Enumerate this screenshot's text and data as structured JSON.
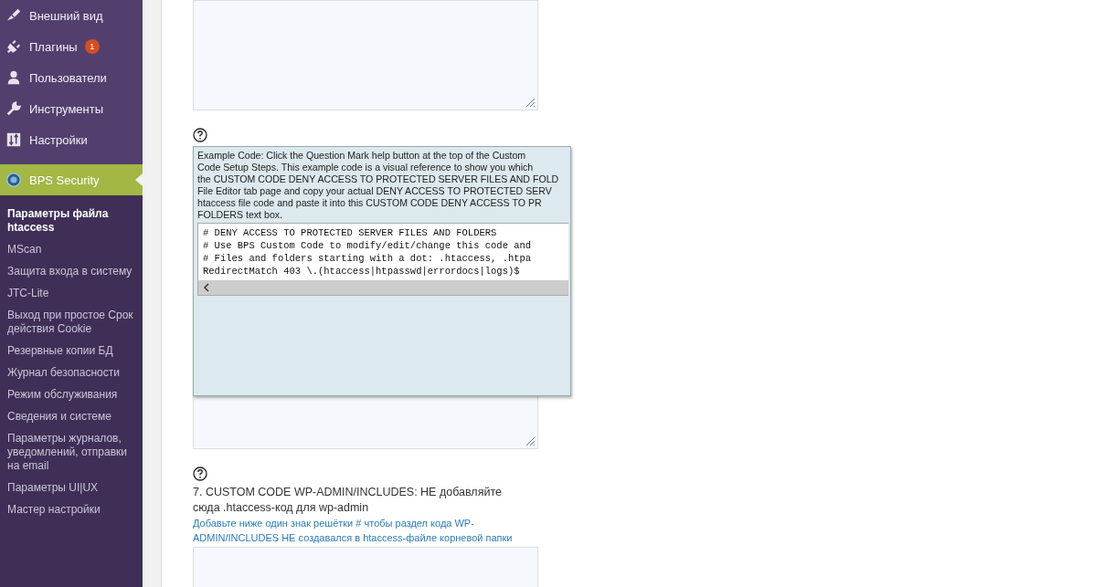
{
  "sidebar": {
    "menu": [
      {
        "label": "Внешний вид",
        "selected": false
      },
      {
        "label": "Плагины",
        "selected": false,
        "badge": "1"
      },
      {
        "label": "Пользователи",
        "selected": false
      },
      {
        "label": "Инструменты",
        "selected": false
      },
      {
        "label": "Настройки",
        "selected": false
      },
      {
        "label": "BPS Security",
        "selected": true
      }
    ],
    "submenu": [
      {
        "label": "Параметры файла htaccess",
        "selected": true
      },
      {
        "label": "MScan",
        "selected": false
      },
      {
        "label": "Защита входа в систему",
        "selected": false
      },
      {
        "label": "JTC-Lite",
        "selected": false
      },
      {
        "label": "Выход при простое Срок действия Cookie",
        "selected": false
      },
      {
        "label": "Резервные копии БД",
        "selected": false
      },
      {
        "label": "Журнал безопасности",
        "selected": false
      },
      {
        "label": "Режим обслуживания",
        "selected": false
      },
      {
        "label": "Сведения и системе",
        "selected": false
      },
      {
        "label": "Параметры журналов, уведомлений, отправки на email",
        "selected": false
      },
      {
        "label": "Параметры UI|UX",
        "selected": false
      },
      {
        "label": "Мастер настройки",
        "selected": false
      }
    ]
  },
  "popup": {
    "lines": [
      "Example Code: Click the Question Mark help button at the top of the Custom",
      "Code Setup Steps. This example code is a visual reference to show you which",
      "the CUSTOM CODE DENY ACCESS TO PROTECTED SERVER FILES AND FOLD",
      "File Editor tab page and copy your actual DENY ACCESS TO PROTECTED SERV",
      "htaccess file code and paste it into this CUSTOM CODE DENY ACCESS TO PR",
      "FOLDERS text box."
    ],
    "code": [
      "# DENY ACCESS TO PROTECTED SERVER FILES AND FOLDERS",
      "# Use BPS Custom Code to modify/edit/change this code and",
      "# Files and folders starting with a dot: .htaccess, .htpa",
      "RedirectMatch 403 \\.(htaccess|htpasswd|errordocs|logs)$"
    ]
  },
  "section7": {
    "title": "7. CUSTOM CODE WP-ADMIN/INCLUDES: НЕ добавляйте сюда .htaccess-код для wp-admin",
    "hint": "Добавьте ниже один знак решётки # чтобы раздел кода WP-ADMIN/INCLUDES НЕ создавался в htaccess-файле корневой папки"
  }
}
